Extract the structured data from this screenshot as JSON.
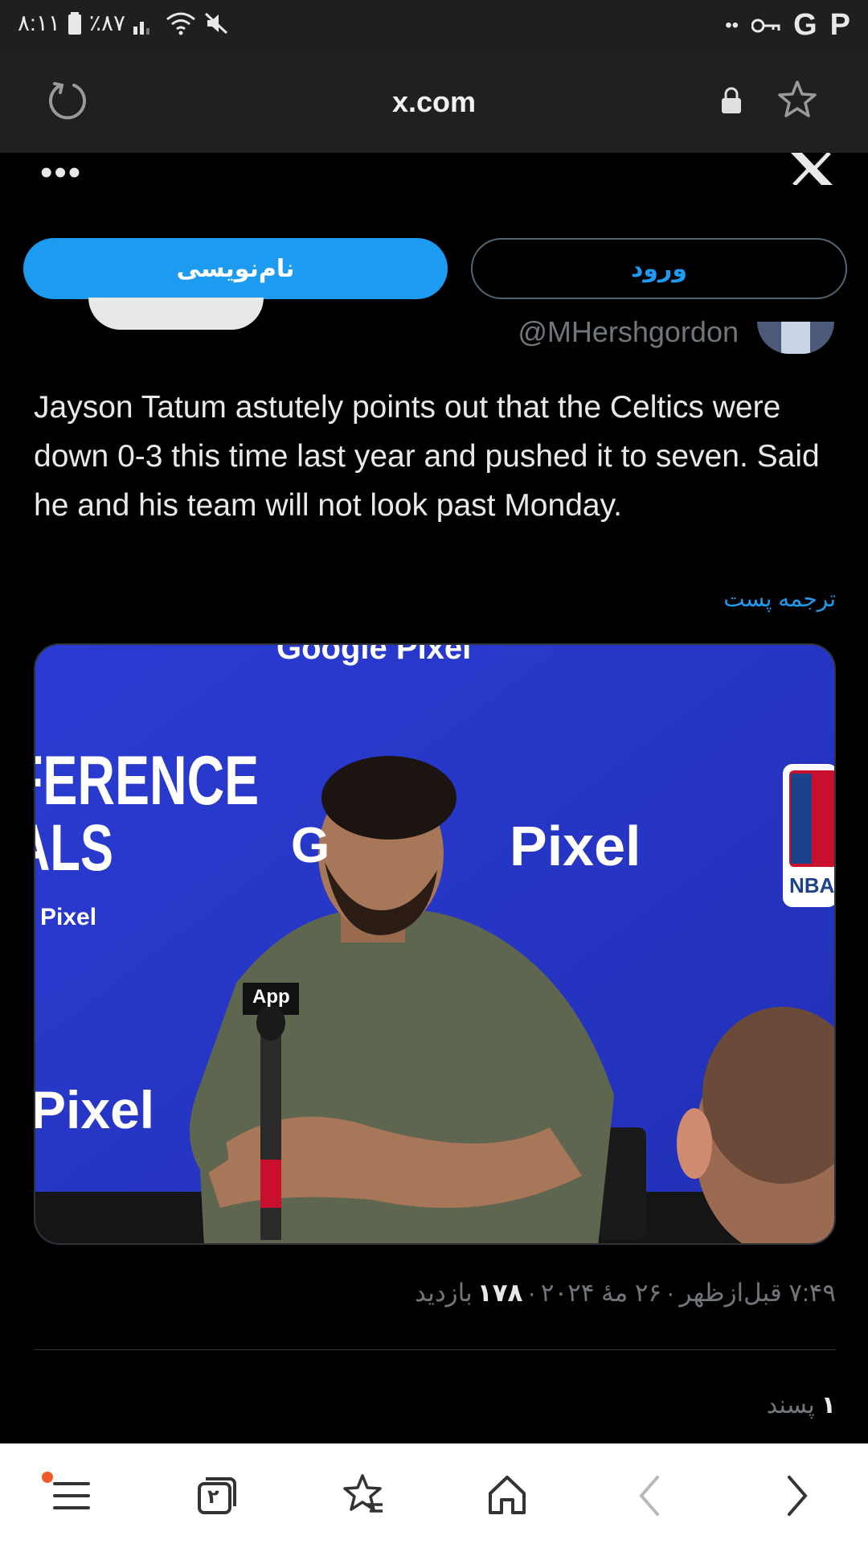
{
  "status_bar": {
    "time": "۸:۱۱",
    "battery": "٪۸۷",
    "right_dots": "••",
    "g_label": "G",
    "p_label": "P"
  },
  "browser": {
    "url": "x.com"
  },
  "header": {
    "login_label": "ورود",
    "signup_label": "نام‌نویسی"
  },
  "tweet": {
    "handle": "@MHershgordon",
    "text": "Jayson Tatum astutely points out that the Celtics were down 0-3 this time last year and pushed it to seven. Said he and his team will not look past Monday.",
    "translate_label": "ترجمه پست",
    "photo_texts": {
      "top_banner": "Google Pixel",
      "conference": "FERENCE",
      "finals": "ALS",
      "pixel_small": "Pixel",
      "pixel_center": "Pixel",
      "g_letter": "G",
      "pixel_bottom": "Pixel",
      "nba": "NBA",
      "mic_flag": "App"
    },
    "time": "۷:۴۹ قبل‌ازظهر",
    "date": "۲۶ مهٔ ۲۰۲۴",
    "separator": "·",
    "views_count": "۱۷۸",
    "views_label": "بازدید",
    "likes_count": "۱",
    "likes_label": "پسند"
  },
  "bottom_nav": {
    "tabs_count": "۲"
  }
}
